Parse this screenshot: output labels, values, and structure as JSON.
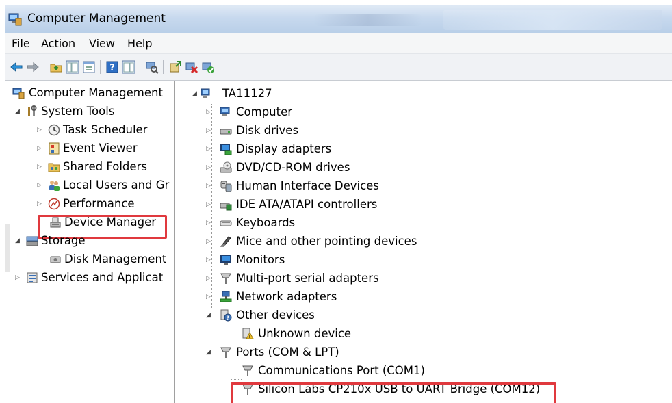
{
  "window": {
    "title": "Computer Management"
  },
  "menu": [
    "File",
    "Action",
    "View",
    "Help"
  ],
  "toolbar": [
    "back-icon",
    "forward-icon",
    "up-folder-icon",
    "show-hide-tree-icon",
    "properties-icon",
    "help-icon",
    "show-hide-action-pane-icon",
    "scan-hardware-icon",
    "update-driver-icon",
    "uninstall-icon",
    "enable-device-icon"
  ],
  "left_tree": {
    "root": "Computer Management",
    "system_tools": "System Tools",
    "task_scheduler": "Task Scheduler",
    "event_viewer": "Event Viewer",
    "shared_folders": "Shared Folders",
    "local_users": "Local Users and Gr",
    "performance": "Performance",
    "device_manager": "Device Manager",
    "storage": "Storage",
    "disk_management": "Disk Management",
    "services": "Services and Applicat"
  },
  "device_tree": {
    "root": "TA11127",
    "categories": [
      "Computer",
      "Disk drives",
      "Display adapters",
      "DVD/CD-ROM drives",
      "Human Interface Devices",
      "IDE ATA/ATAPI controllers",
      "Keyboards",
      "Mice and other pointing devices",
      "Monitors",
      "Multi-port serial adapters",
      "Network adapters"
    ],
    "other_devices": "Other devices",
    "unknown_device": "Unknown device",
    "ports": "Ports (COM & LPT)",
    "com1": "Communications Port (COM1)",
    "com12": "Silicon Labs CP210x USB to UART Bridge (COM12)"
  },
  "colors": {
    "highlight": "#e0393e",
    "title_bg": "#c7d9ee"
  }
}
